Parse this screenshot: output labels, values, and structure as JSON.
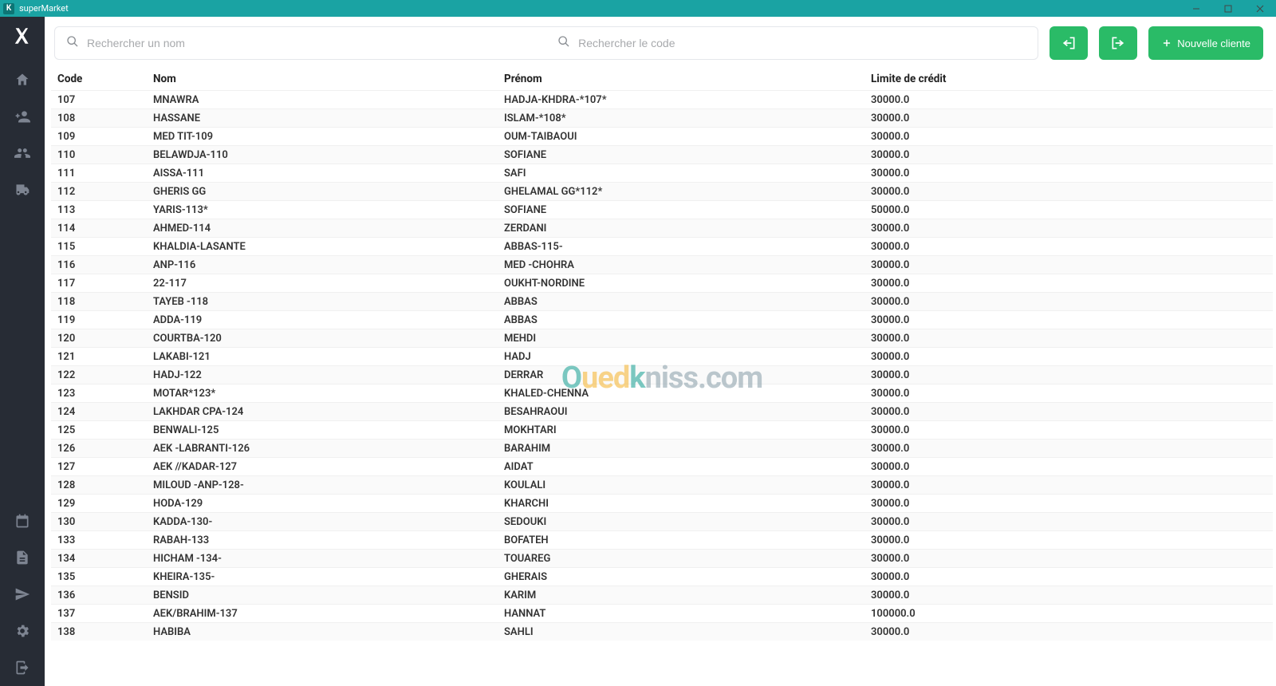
{
  "window": {
    "title": "superMarket"
  },
  "toolbar": {
    "search_name_placeholder": "Rechercher un nom",
    "search_code_placeholder": "Rechercher le code",
    "new_client_label": "Nouvelle cliente"
  },
  "table": {
    "headers": {
      "code": "Code",
      "nom": "Nom",
      "prenom": "Prénom",
      "limit": "Limite de crédit"
    },
    "rows": [
      {
        "code": "107",
        "nom": "MNAWRA",
        "prenom": "HADJA-KHDRA-*107*",
        "limit": "30000.0"
      },
      {
        "code": "108",
        "nom": "HASSANE",
        "prenom": "ISLAM-*108*",
        "limit": "30000.0"
      },
      {
        "code": "109",
        "nom": "MED TIT-109",
        "prenom": "OUM-TAIBAOUI",
        "limit": "30000.0"
      },
      {
        "code": "110",
        "nom": "BELAWDJA-110",
        "prenom": "SOFIANE",
        "limit": "30000.0"
      },
      {
        "code": "111",
        "nom": "AISSA-111",
        "prenom": "SAFI",
        "limit": "30000.0"
      },
      {
        "code": "112",
        "nom": "GHERIS  GG",
        "prenom": "GHELAMAL  GG*112*",
        "limit": "30000.0"
      },
      {
        "code": "113",
        "nom": "YARIS-113*",
        "prenom": "SOFIANE",
        "limit": "50000.0"
      },
      {
        "code": "114",
        "nom": "AHMED-114",
        "prenom": "ZERDANI",
        "limit": "30000.0"
      },
      {
        "code": "115",
        "nom": "KHALDIA-LASANTE",
        "prenom": "ABBAS-115-",
        "limit": "30000.0"
      },
      {
        "code": "116",
        "nom": "ANP-116",
        "prenom": "MED -CHOHRA",
        "limit": "30000.0"
      },
      {
        "code": "117",
        "nom": "22-117",
        "prenom": "OUKHT-NORDINE",
        "limit": "30000.0"
      },
      {
        "code": "118",
        "nom": "TAYEB -118",
        "prenom": "ABBAS",
        "limit": "30000.0"
      },
      {
        "code": "119",
        "nom": "ADDA-119",
        "prenom": "ABBAS",
        "limit": "30000.0"
      },
      {
        "code": "120",
        "nom": "COURTBA-120",
        "prenom": "MEHDI",
        "limit": "30000.0"
      },
      {
        "code": "121",
        "nom": "LAKABI-121",
        "prenom": "HADJ",
        "limit": "30000.0"
      },
      {
        "code": "122",
        "nom": "HADJ-122",
        "prenom": "DERRAR",
        "limit": "30000.0"
      },
      {
        "code": "123",
        "nom": "MOTAR*123*",
        "prenom": "KHALED-CHENNA",
        "limit": "30000.0"
      },
      {
        "code": "124",
        "nom": "LAKHDAR CPA-124",
        "prenom": "BESAHRAOUI",
        "limit": "30000.0"
      },
      {
        "code": "125",
        "nom": "BENWALI-125",
        "prenom": "MOKHTARI",
        "limit": "30000.0"
      },
      {
        "code": "126",
        "nom": "AEK -LABRANTI-126",
        "prenom": "BARAHIM",
        "limit": "30000.0"
      },
      {
        "code": "127",
        "nom": "AEK //KADAR-127",
        "prenom": "AIDAT",
        "limit": "30000.0"
      },
      {
        "code": "128",
        "nom": "MILOUD -ANP-128-",
        "prenom": "KOULALI",
        "limit": "30000.0"
      },
      {
        "code": "129",
        "nom": "HODA-129",
        "prenom": "KHARCHI",
        "limit": "30000.0"
      },
      {
        "code": "130",
        "nom": "KADDA-130-",
        "prenom": "SEDOUKI",
        "limit": "30000.0"
      },
      {
        "code": "133",
        "nom": "RABAH-133",
        "prenom": "BOFATEH",
        "limit": "30000.0"
      },
      {
        "code": "134",
        "nom": "HICHAM -134-",
        "prenom": "TOUAREG",
        "limit": "30000.0"
      },
      {
        "code": "135",
        "nom": "KHEIRA-135-",
        "prenom": "GHERAIS",
        "limit": "30000.0"
      },
      {
        "code": "136",
        "nom": "BENSID",
        "prenom": "KARIM",
        "limit": "30000.0"
      },
      {
        "code": "137",
        "nom": "AEK/BRAHIM-137",
        "prenom": "HANNAT",
        "limit": "100000.0"
      },
      {
        "code": "138",
        "nom": "HABIBA",
        "prenom": "SAHLI",
        "limit": "30000.0"
      }
    ]
  },
  "watermark": {
    "o": "O",
    "ued": "ued",
    "k": "k",
    "rest": "niss.com"
  }
}
